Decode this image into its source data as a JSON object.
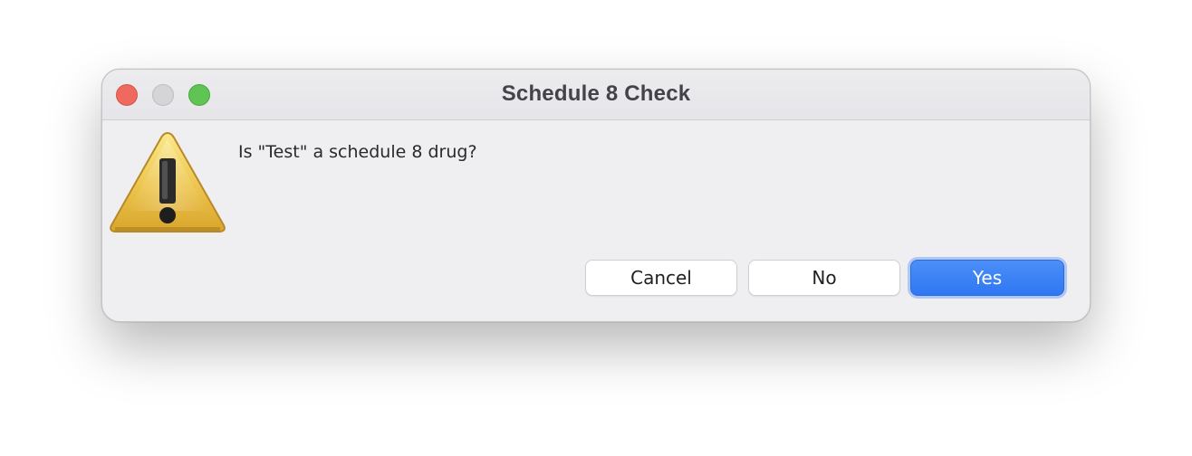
{
  "window": {
    "title": "Schedule 8 Check",
    "controls": {
      "close": "close-icon",
      "minimize": "minimize-icon",
      "maximize": "maximize-icon"
    }
  },
  "dialog": {
    "icon": "warning-icon",
    "message": "Is \"Test\" a schedule 8 drug?",
    "buttons": {
      "cancel": "Cancel",
      "no": "No",
      "yes": "Yes"
    },
    "default_button": "yes"
  },
  "colors": {
    "accent": "#2f77f2",
    "close": "#ee6a5e",
    "maximize": "#5fc454",
    "warning": "#e9c040"
  }
}
